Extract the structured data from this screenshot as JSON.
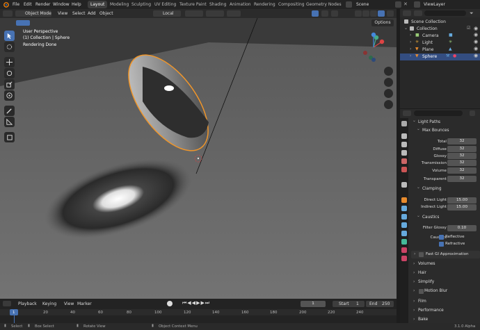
{
  "menu": [
    "File",
    "Edit",
    "Render",
    "Window",
    "Help"
  ],
  "workspaces": [
    "Layout",
    "Modeling",
    "Sculpting",
    "UV Editing",
    "Texture Paint",
    "Shading",
    "Animation",
    "Rendering",
    "Compositing",
    "Geometry Nodes"
  ],
  "active_workspace": "Layout",
  "scene_name": "Scene",
  "view_layer": "ViewLayer",
  "viewport": {
    "mode": "Object Mode",
    "menus": [
      "View",
      "Select",
      "Add",
      "Object"
    ],
    "transform": "Local",
    "options": "Options",
    "info_line1": "User Perspective",
    "info_line2": "(1) Collection | Sphere",
    "info_line3": "Rendering Done"
  },
  "outliner": {
    "root": "Scene Collection",
    "collection": "Collection",
    "items": [
      "Camera",
      "Light",
      "Plane",
      "Sphere"
    ],
    "selected": "Sphere"
  },
  "properties": {
    "search_placeholder": "",
    "light_paths": "Light Paths",
    "max_bounces": "Max Bounces",
    "bounces": [
      {
        "label": "Total",
        "value": "32"
      },
      {
        "label": "Diffuse",
        "value": "32"
      },
      {
        "label": "Glossy",
        "value": "32"
      },
      {
        "label": "Transmission",
        "value": "32"
      },
      {
        "label": "Volume",
        "value": "32"
      }
    ],
    "transparent": {
      "label": "Transparent",
      "value": "32"
    },
    "clamping": "Clamping",
    "direct_light": {
      "label": "Direct Light",
      "value": "15.00"
    },
    "indirect_light": {
      "label": "Indirect Light",
      "value": "15.00"
    },
    "caustics": "Caustics",
    "filter_glossy": {
      "label": "Filter Glossy",
      "value": "0.10"
    },
    "caustics_label": "Caustics",
    "reflective": "Reflective",
    "refractive": "Refractive",
    "fast_gi": "Fast GI Approximation",
    "sections": [
      "Volumes",
      "Hair",
      "Simplify",
      "Motion Blur",
      "Film",
      "Performance",
      "Bake"
    ]
  },
  "timeline": {
    "menus": [
      "Playback",
      "Keying",
      "View",
      "Marker"
    ],
    "current_frame": "1",
    "start_label": "Start",
    "start": "1",
    "end_label": "End",
    "end": "250",
    "ticks": [
      "1",
      "20",
      "40",
      "60",
      "80",
      "100",
      "120",
      "140",
      "160",
      "180",
      "200",
      "220",
      "240"
    ]
  },
  "status": {
    "select": "Select",
    "box_select": "Box Select",
    "rotate_view": "Rotate View",
    "context_menu": "Object Context Menu",
    "version": "3.1.0 Alpha"
  },
  "colors": {
    "accent": "#4772b3",
    "selection": "#f0962a",
    "header": "#2b2b2b"
  }
}
